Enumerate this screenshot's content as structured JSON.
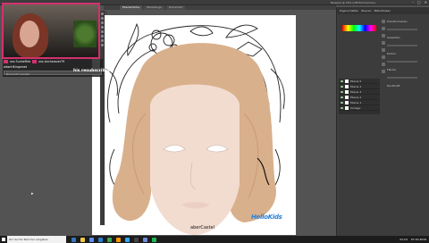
{
  "window": {
    "title": "Beispiel @ 50% (CMYK/Vorschau)",
    "controls": [
      "–",
      "□",
      "✕"
    ]
  },
  "tabs": [
    "Ebenenfarbe",
    "Werkzeuge",
    "Dokument"
  ],
  "active_tab": 0,
  "panels": {
    "tabs": [
      "Eigenschaften",
      "Ebenen",
      "Bibliotheken"
    ],
    "layers": [
      {
        "name": "Ebene 5"
      },
      {
        "name": "Ebene 4"
      },
      {
        "name": "Ebene 3"
      },
      {
        "name": "Ebene 2"
      },
      {
        "name": "Ebene 1"
      },
      {
        "name": "Vorlage"
      }
    ],
    "labels": [
      "Transformieren",
      "Aussehen",
      "Kontur",
      "Fläche",
      "Deckkraft"
    ]
  },
  "stream": {
    "chat": [
      {
        "user": "xxx SunheRrie",
        "msg": "xxx Anchorover79"
      },
      {
        "user": "wlianHKingamet",
        "msg": ""
      }
    ],
    "chat_placeholder": "Nachricht senden",
    "resub_notice": "his resubscribed",
    "accent": "#d3306f"
  },
  "artwork": {
    "brand_text": "aberCastel",
    "logo_text": "HelloKids"
  },
  "taskbar": {
    "search_placeholder": "Zur Suche Text hier eingeben",
    "time": "21:14",
    "date": "07.10.2019",
    "icons": [
      "edge-icon",
      "explorer-icon",
      "store-icon",
      "mail-icon",
      "chrome-icon",
      "illustrator-icon",
      "photoshop-icon",
      "obs-icon",
      "discord-icon",
      "spotify-icon"
    ]
  }
}
